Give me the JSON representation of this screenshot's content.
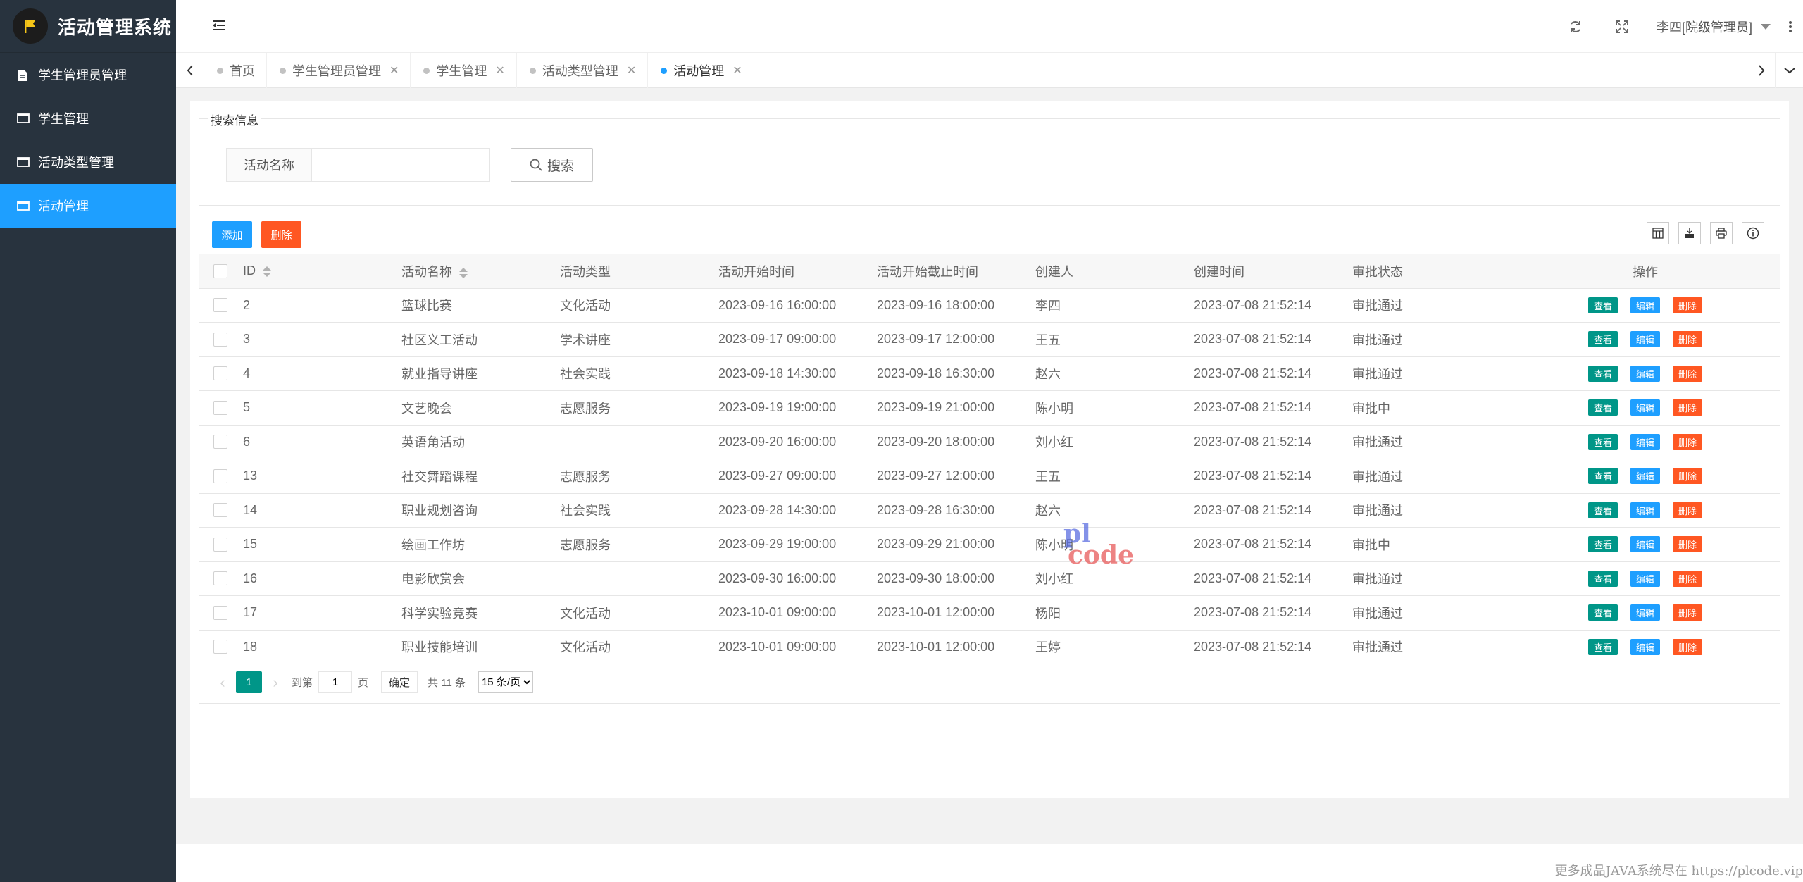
{
  "app": {
    "title": "活动管理系统"
  },
  "sidebar": {
    "items": [
      {
        "label": "学生管理员管理",
        "icon": "file-icon",
        "active": false
      },
      {
        "label": "学生管理",
        "icon": "window-icon",
        "active": false
      },
      {
        "label": "活动类型管理",
        "icon": "window-icon",
        "active": false
      },
      {
        "label": "活动管理",
        "icon": "window-icon",
        "active": true
      }
    ]
  },
  "topbar": {
    "user": "李四[院级管理员]"
  },
  "tabs": [
    {
      "label": "首页",
      "closable": false,
      "active": false
    },
    {
      "label": "学生管理员管理",
      "closable": true,
      "active": false
    },
    {
      "label": "学生管理",
      "closable": true,
      "active": false
    },
    {
      "label": "活动类型管理",
      "closable": true,
      "active": false
    },
    {
      "label": "活动管理",
      "closable": true,
      "active": true
    }
  ],
  "search": {
    "legend": "搜索信息",
    "field_label": "活动名称",
    "value": "",
    "button": "搜索"
  },
  "toolbar": {
    "add": "添加",
    "delete": "删除"
  },
  "table": {
    "columns": [
      "ID",
      "活动名称",
      "活动类型",
      "活动开始时间",
      "活动开始截止时间",
      "创建人",
      "创建时间",
      "审批状态",
      "操作"
    ],
    "ops": {
      "view": "查看",
      "edit": "编辑",
      "delete": "删除"
    },
    "rows": [
      [
        "2",
        "篮球比赛",
        "文化活动",
        "2023-09-16 16:00:00",
        "2023-09-16 18:00:00",
        "李四",
        "2023-07-08 21:52:14",
        "审批通过"
      ],
      [
        "3",
        "社区义工活动",
        "学术讲座",
        "2023-09-17 09:00:00",
        "2023-09-17 12:00:00",
        "王五",
        "2023-07-08 21:52:14",
        "审批通过"
      ],
      [
        "4",
        "就业指导讲座",
        "社会实践",
        "2023-09-18 14:30:00",
        "2023-09-18 16:30:00",
        "赵六",
        "2023-07-08 21:52:14",
        "审批通过"
      ],
      [
        "5",
        "文艺晚会",
        "志愿服务",
        "2023-09-19 19:00:00",
        "2023-09-19 21:00:00",
        "陈小明",
        "2023-07-08 21:52:14",
        "审批中"
      ],
      [
        "6",
        "英语角活动",
        "",
        "2023-09-20 16:00:00",
        "2023-09-20 18:00:00",
        "刘小红",
        "2023-07-08 21:52:14",
        "审批通过"
      ],
      [
        "13",
        "社交舞蹈课程",
        "志愿服务",
        "2023-09-27 09:00:00",
        "2023-09-27 12:00:00",
        "王五",
        "2023-07-08 21:52:14",
        "审批通过"
      ],
      [
        "14",
        "职业规划咨询",
        "社会实践",
        "2023-09-28 14:30:00",
        "2023-09-28 16:30:00",
        "赵六",
        "2023-07-08 21:52:14",
        "审批通过"
      ],
      [
        "15",
        "绘画工作坊",
        "志愿服务",
        "2023-09-29 19:00:00",
        "2023-09-29 21:00:00",
        "陈小明",
        "2023-07-08 21:52:14",
        "审批中"
      ],
      [
        "16",
        "电影欣赏会",
        "",
        "2023-09-30 16:00:00",
        "2023-09-30 18:00:00",
        "刘小红",
        "2023-07-08 21:52:14",
        "审批通过"
      ],
      [
        "17",
        "科学实验竞赛",
        "文化活动",
        "2023-10-01 09:00:00",
        "2023-10-01 12:00:00",
        "杨阳",
        "2023-07-08 21:52:14",
        "审批通过"
      ],
      [
        "18",
        "职业技能培训",
        "文化活动",
        "2023-10-01 09:00:00",
        "2023-10-01 12:00:00",
        "王婷",
        "2023-07-08 21:52:14",
        "审批通过"
      ]
    ]
  },
  "pager": {
    "current": "1",
    "goto_prefix": "到第",
    "goto_value": "1",
    "goto_suffix": "页",
    "confirm": "确定",
    "total": "共 11 条",
    "per_page": "15 条/页"
  },
  "watermark": {
    "line1": "pl",
    "line2": "code"
  },
  "footer": {
    "text": "更多成品JAVA系统尽在 https://plcode.vip"
  }
}
